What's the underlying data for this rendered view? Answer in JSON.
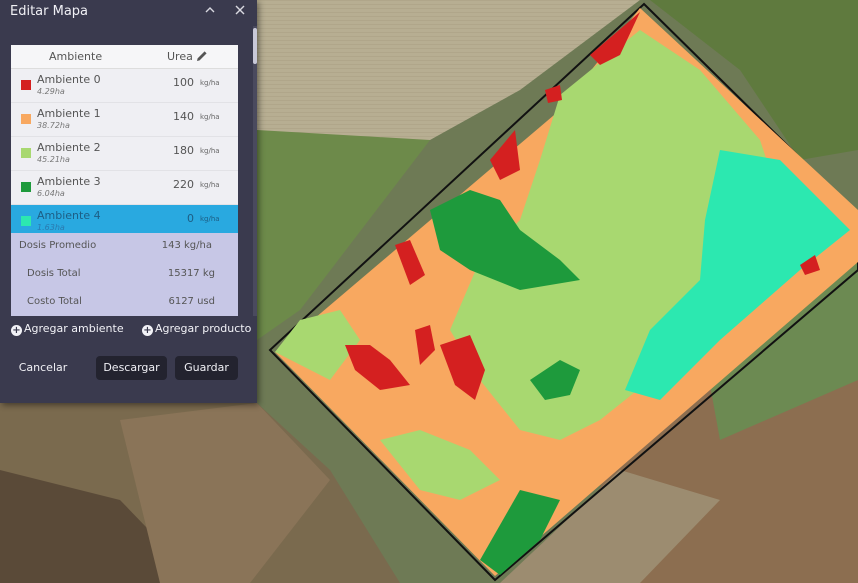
{
  "panel": {
    "title": "Editar Mapa",
    "collapse_icon": "chevron-up-icon",
    "close_icon": "close-icon"
  },
  "table": {
    "col_ambiente": "Ambiente",
    "col_urea": "Urea",
    "edit_icon": "pencil-icon",
    "rows": [
      {
        "name": "Ambiente 0",
        "area": "4.29ha",
        "value": "100",
        "unit": "kg/ha",
        "color": "#d42020"
      },
      {
        "name": "Ambiente 1",
        "area": "38.72ha",
        "value": "140",
        "unit": "kg/ha",
        "color": "#f8a860"
      },
      {
        "name": "Ambiente 2",
        "area": "45.21ha",
        "value": "180",
        "unit": "kg/ha",
        "color": "#a8d870"
      },
      {
        "name": "Ambiente 3",
        "area": "6.04ha",
        "value": "220",
        "unit": "kg/ha",
        "color": "#1e9a3c"
      },
      {
        "name": "Ambiente 4",
        "area": "1.63ha",
        "value": "0",
        "unit": "kg/ha",
        "color": "#2ce8b0"
      }
    ]
  },
  "summary": {
    "dosis_promedio_label": "Dosis Promedio",
    "dosis_promedio_value": "143 kg/ha",
    "dosis_total_label": "Dosis Total",
    "dosis_total_value": "15317 kg",
    "costo_total_label": "Costo Total",
    "costo_total_value": "6127 usd"
  },
  "actions": {
    "add_ambiente": "Agregar ambiente",
    "add_producto": "Agregar producto",
    "cancel": "Cancelar",
    "download": "Descargar",
    "save": "Guardar"
  }
}
